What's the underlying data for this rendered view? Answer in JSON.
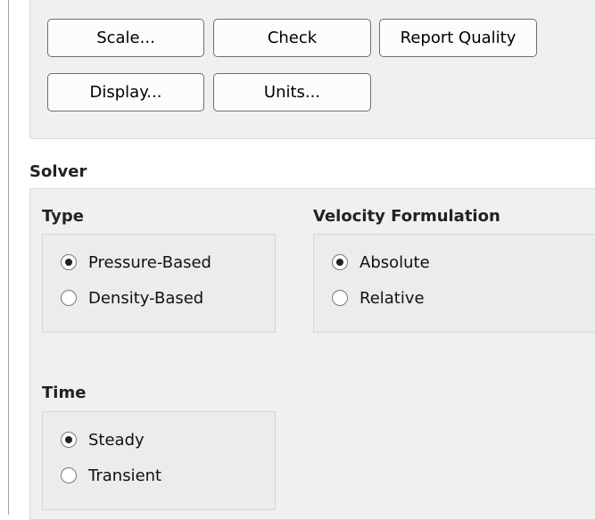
{
  "mesh": {
    "buttons": {
      "scale": "Scale...",
      "check": "Check",
      "report_quality": "Report Quality",
      "display": "Display...",
      "units": "Units..."
    }
  },
  "solver": {
    "title": "Solver",
    "type": {
      "title": "Type",
      "options": [
        {
          "label": "Pressure-Based",
          "selected": true
        },
        {
          "label": "Density-Based",
          "selected": false
        }
      ]
    },
    "velocity_formulation": {
      "title": "Velocity Formulation",
      "options": [
        {
          "label": "Absolute",
          "selected": true
        },
        {
          "label": "Relative",
          "selected": false
        }
      ]
    },
    "time": {
      "title": "Time",
      "options": [
        {
          "label": "Steady",
          "selected": true
        },
        {
          "label": "Transient",
          "selected": false
        }
      ]
    }
  }
}
